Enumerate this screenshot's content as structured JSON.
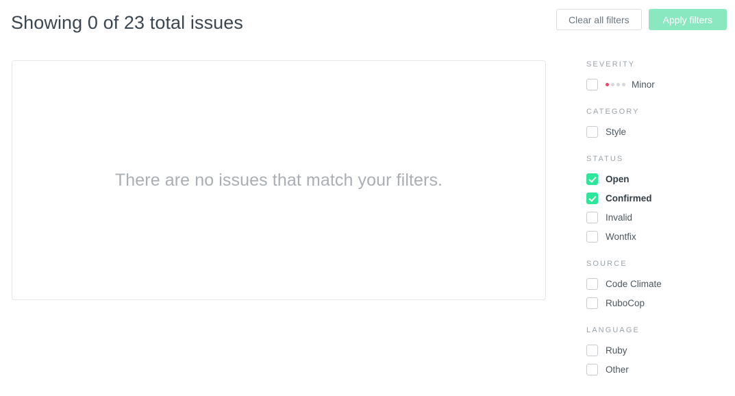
{
  "header": {
    "title": "Showing 0 of 23 total issues",
    "clear_button": "Clear all filters",
    "apply_button": "Apply filters"
  },
  "main": {
    "empty_message": "There are no issues that match your filters."
  },
  "colors": {
    "accent_green": "#2ce69b",
    "apply_button_green": "#8ae8c0",
    "severity_minor_dot": "#e9476a",
    "dot_inactive": "#d3d8dc",
    "panel_border": "#e4e6e8"
  },
  "filters": {
    "groups": [
      {
        "title": "Severity",
        "items": [
          {
            "label": "Minor",
            "checked": false,
            "dots_total": 4,
            "dots_active": 1
          }
        ]
      },
      {
        "title": "Category",
        "items": [
          {
            "label": "Style",
            "checked": false
          }
        ]
      },
      {
        "title": "Status",
        "items": [
          {
            "label": "Open",
            "checked": true
          },
          {
            "label": "Confirmed",
            "checked": true
          },
          {
            "label": "Invalid",
            "checked": false
          },
          {
            "label": "Wontfix",
            "checked": false
          }
        ]
      },
      {
        "title": "Source",
        "items": [
          {
            "label": "Code Climate",
            "checked": false
          },
          {
            "label": "RuboCop",
            "checked": false
          }
        ]
      },
      {
        "title": "Language",
        "items": [
          {
            "label": "Ruby",
            "checked": false
          },
          {
            "label": "Other",
            "checked": false
          }
        ]
      }
    ]
  }
}
